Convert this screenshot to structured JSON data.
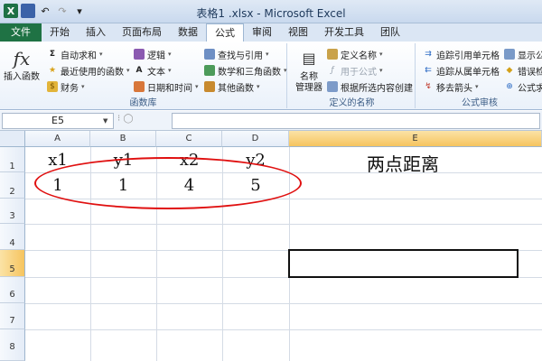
{
  "window": {
    "title": "表格1 .xlsx - Microsoft Excel"
  },
  "tabs": [
    "文件",
    "开始",
    "插入",
    "页面布局",
    "数据",
    "公式",
    "审阅",
    "视图",
    "开发工具",
    "团队"
  ],
  "ribbon": {
    "insert_function": "插入函数",
    "autosum": "自动求和",
    "recent": "最近使用的函数",
    "financial": "财务",
    "logical": "逻辑",
    "text": "文本",
    "datetime": "日期和时间",
    "lookup": "查找与引用",
    "math": "数学和三角函数",
    "other": "其他函数",
    "group_library": "函数库",
    "name_manager_1": "名称",
    "name_manager_2": "管理器",
    "define_name": "定义名称",
    "use_in_formula": "用于公式",
    "create_from_sel": "根据所选内容创建",
    "group_names": "定义的名称",
    "trace_precedents": "追踪引用单元格",
    "trace_dependents": "追踪从属单元格",
    "remove_arrows": "移去箭头",
    "show_formulas": "显示公",
    "error_check": "错误检",
    "evaluate": "公式求",
    "group_audit": "公式审核"
  },
  "formula_bar": {
    "name_box": "E5",
    "value": ""
  },
  "columns": [
    "A",
    "B",
    "C",
    "D",
    "E"
  ],
  "rows": [
    "1",
    "2",
    "3",
    "4",
    "5",
    "6",
    "7",
    "8"
  ],
  "cells": {
    "A1": "x1",
    "B1": "y1",
    "C1": "x2",
    "D1": "y2",
    "E1": "两点距离",
    "A2": "1",
    "B2": "1",
    "C2": "4",
    "D2": "5"
  },
  "colors": {
    "file_tab": "#1f7244",
    "annotation": "#e01010",
    "selection": "#f6c45f"
  }
}
